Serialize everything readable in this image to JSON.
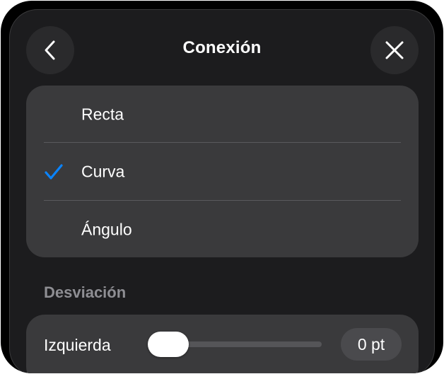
{
  "header": {
    "title": "Conexión",
    "back_icon": "chevron-left-icon",
    "close_icon": "close-icon"
  },
  "options": {
    "items": [
      {
        "label": "Recta",
        "selected": false
      },
      {
        "label": "Curva",
        "selected": true
      },
      {
        "label": "Ángulo",
        "selected": false
      }
    ],
    "check_icon": "checkmark-icon",
    "accent_color": "#0a84ff"
  },
  "deviation": {
    "section_title": "Desviación",
    "left_label": "Izquierda",
    "value": "0 pt",
    "slider_fraction": 0
  }
}
